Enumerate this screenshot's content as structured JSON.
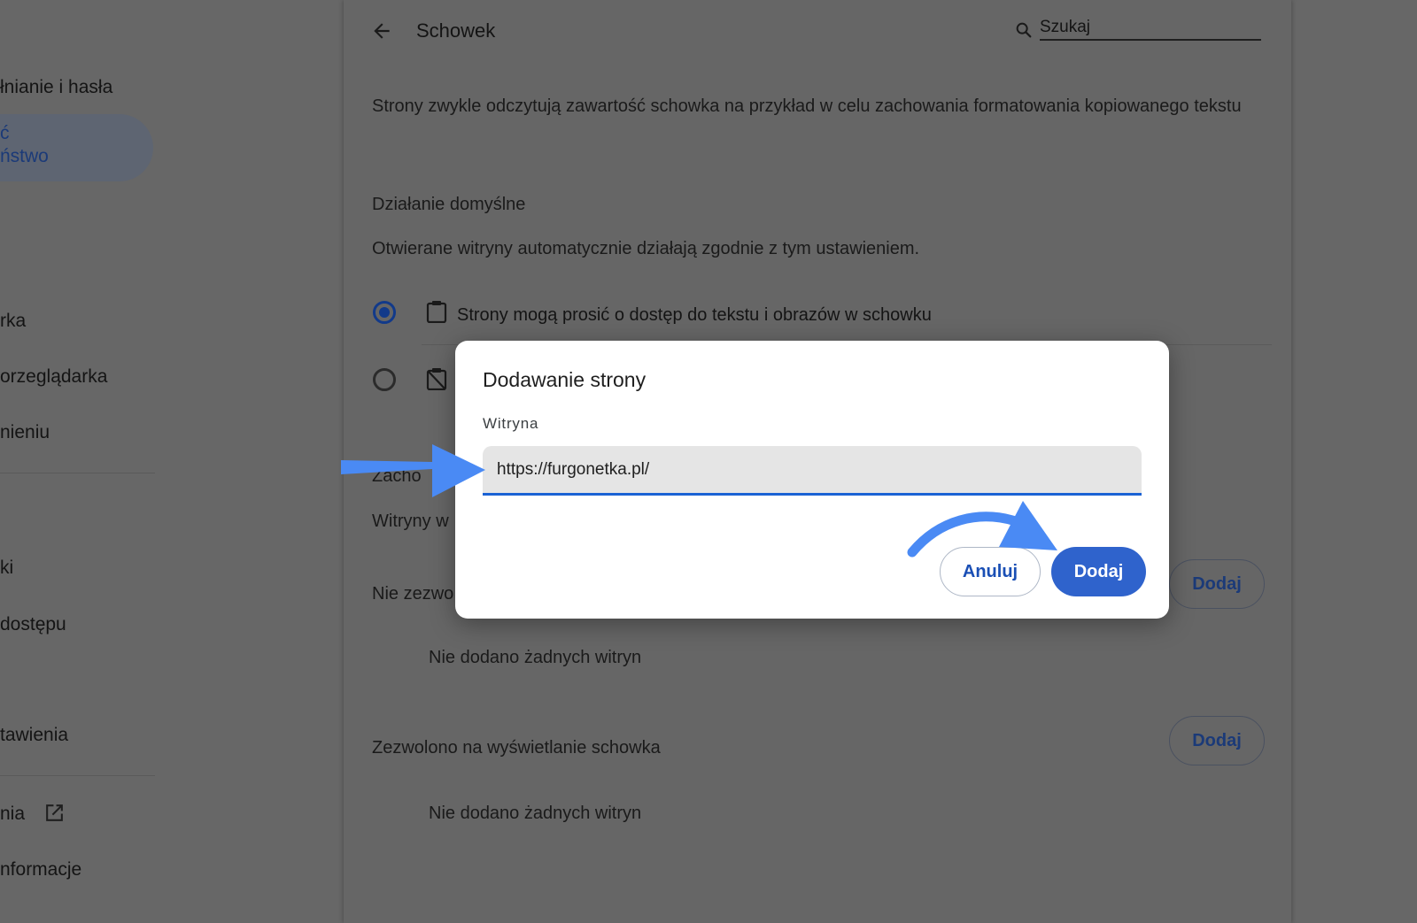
{
  "sidebar": {
    "items": [
      {
        "label": "łnianie i hasła"
      },
      {
        "label": "rka"
      },
      {
        "label": "orzeglądarka"
      },
      {
        "label": "nieniu"
      },
      {
        "label": "ki"
      },
      {
        "label": "dostępu"
      },
      {
        "label": "tawienia"
      },
      {
        "label": "nia"
      },
      {
        "label": "nformacje"
      }
    ],
    "active": {
      "line1": "ć",
      "line2": "ństwo"
    }
  },
  "header": {
    "title": "Schowek",
    "search_placeholder": "Szukaj"
  },
  "main": {
    "description": "Strony zwykle odczytują zawartość schowka na przykład w celu zachowania formatowania kopiowanego tekstu",
    "default_heading": "Działanie domyślne",
    "default_sub": "Otwierane witryny automatycznie działają zgodnie z tym ustawieniem.",
    "option_allow": "Strony mogą prosić o dostęp do tekstu i obrazów w schowku",
    "custom_heading_partial": "Zacho",
    "custom_sub_partial": "Witryny w",
    "blocked_partial": "Nie zezwo",
    "blocked_add": "Dodaj",
    "blocked_empty": "Nie dodano żadnych witryn",
    "allowed_heading": "Zezwolono na wyświetlanie schowka",
    "allowed_add": "Dodaj",
    "allowed_empty": "Nie dodano żadnych witryn"
  },
  "dialog": {
    "title": "Dodawanie strony",
    "field_label": "Witryna",
    "field_value": "https://furgonetka.pl/",
    "cancel_label": "Anuluj",
    "add_label": "Dodaj"
  },
  "colors": {
    "accent": "#2f63cc",
    "annotation_arrow": "#4a8af4",
    "overlay": "#676767"
  }
}
